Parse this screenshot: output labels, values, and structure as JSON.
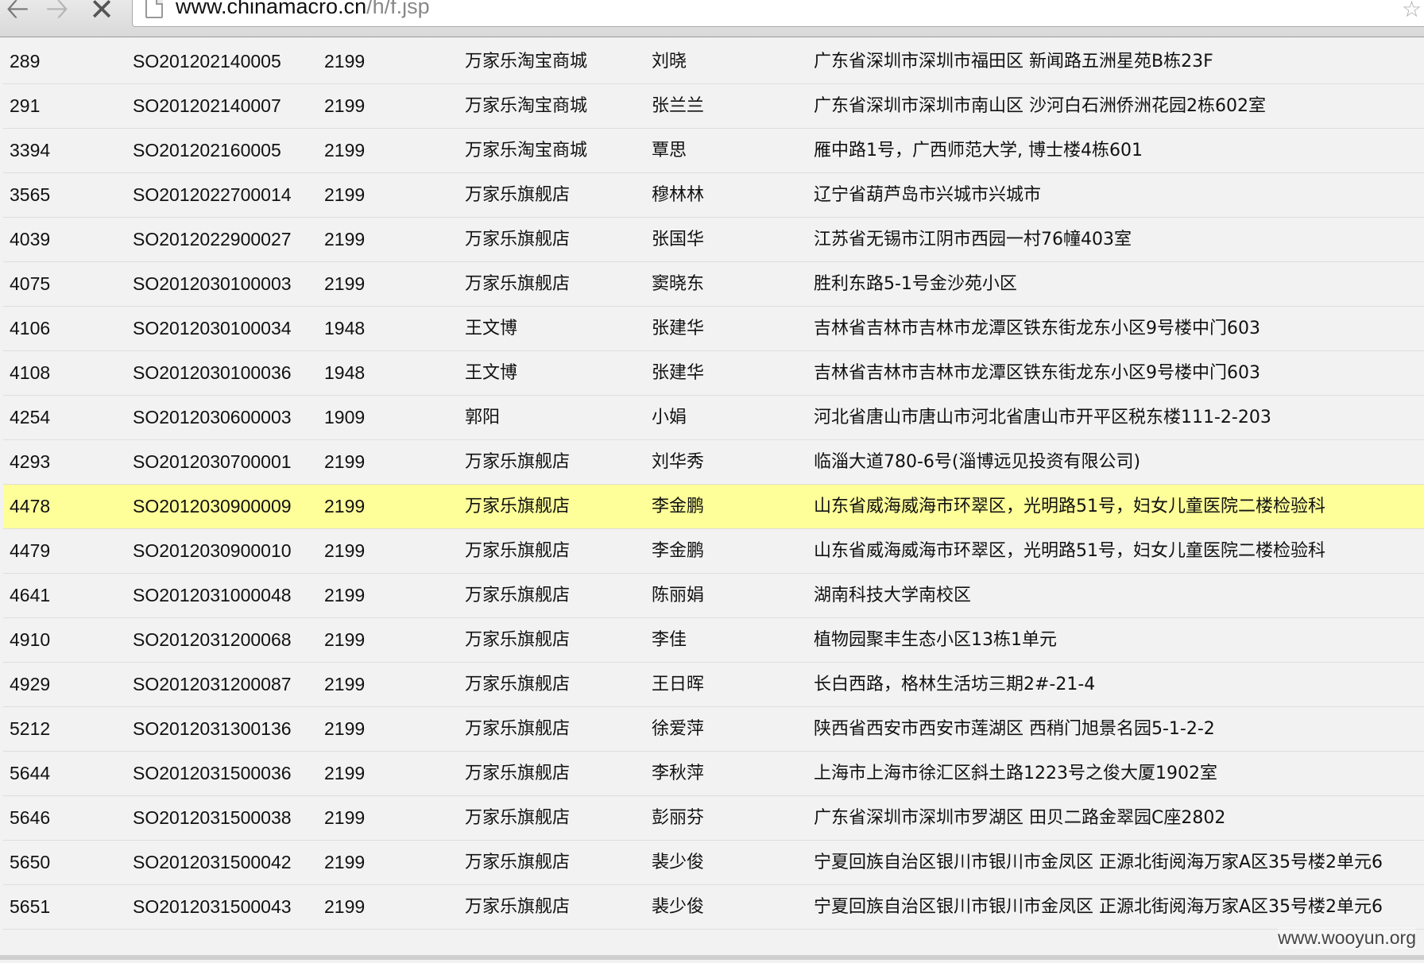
{
  "browser": {
    "url_host": "www.chinamacro.cn",
    "url_path": "/h/f.jsp",
    "back_icon": "🡠",
    "forward_icon": "🡢",
    "stop_icon": "✕",
    "star_icon": "☆"
  },
  "table": {
    "highlight_color": "#ffff99",
    "rows": [
      {
        "id": "289",
        "order": "SO201202140005",
        "code": "2199",
        "store": "万家乐淘宝商城",
        "name": "刘晓",
        "address": "广东省深圳市深圳市福田区 新闻路五洲星苑B栋23F"
      },
      {
        "id": "291",
        "order": "SO201202140007",
        "code": "2199",
        "store": "万家乐淘宝商城",
        "name": "张兰兰",
        "address": "广东省深圳市深圳市南山区 沙河白石洲侨洲花园2栋602室"
      },
      {
        "id": "3394",
        "order": "SO201202160005",
        "code": "2199",
        "store": "万家乐淘宝商城",
        "name": "覃思",
        "address": "雁中路1号，广西师范大学, 博士楼4栋601"
      },
      {
        "id": "3565",
        "order": "SO2012022700014",
        "code": "2199",
        "store": "万家乐旗舰店",
        "name": "穆林林",
        "address": "辽宁省葫芦岛市兴城市兴城市"
      },
      {
        "id": "4039",
        "order": "SO2012022900027",
        "code": "2199",
        "store": "万家乐旗舰店",
        "name": "张国华",
        "address": "江苏省无锡市江阴市西园一村76幢403室"
      },
      {
        "id": "4075",
        "order": "SO2012030100003",
        "code": "2199",
        "store": "万家乐旗舰店",
        "name": "窦晓东",
        "address": "胜利东路5-1号金沙苑小区"
      },
      {
        "id": "4106",
        "order": "SO2012030100034",
        "code": "1948",
        "store": "王文博",
        "name": "张建华",
        "address": "吉林省吉林市吉林市龙潭区铁东街龙东小区9号楼中门603"
      },
      {
        "id": "4108",
        "order": "SO2012030100036",
        "code": "1948",
        "store": "王文博",
        "name": "张建华",
        "address": "吉林省吉林市吉林市龙潭区铁东街龙东小区9号楼中门603"
      },
      {
        "id": "4254",
        "order": "SO2012030600003",
        "code": "1909",
        "store": "郭阳",
        "name": "小娟",
        "address": "河北省唐山市唐山市河北省唐山市开平区税东楼111-2-203"
      },
      {
        "id": "4293",
        "order": "SO2012030700001",
        "code": "2199",
        "store": "万家乐旗舰店",
        "name": "刘华秀",
        "address": "临淄大道780-6号(淄博远见投资有限公司)"
      },
      {
        "id": "4478",
        "order": "SO2012030900009",
        "code": "2199",
        "store": "万家乐旗舰店",
        "name": "李金鹏",
        "address": "山东省威海威海市环翠区，光明路51号，妇女儿童医院二楼检验科",
        "highlight": true
      },
      {
        "id": "4479",
        "order": "SO2012030900010",
        "code": "2199",
        "store": "万家乐旗舰店",
        "name": "李金鹏",
        "address": "山东省威海威海市环翠区，光明路51号，妇女儿童医院二楼检验科"
      },
      {
        "id": "4641",
        "order": "SO2012031000048",
        "code": "2199",
        "store": "万家乐旗舰店",
        "name": "陈丽娟",
        "address": "湖南科技大学南校区"
      },
      {
        "id": "4910",
        "order": "SO2012031200068",
        "code": "2199",
        "store": "万家乐旗舰店",
        "name": "李佳",
        "address": "植物园聚丰生态小区13栋1单元"
      },
      {
        "id": "4929",
        "order": "SO2012031200087",
        "code": "2199",
        "store": "万家乐旗舰店",
        "name": "王日晖",
        "address": "长白西路，格林生活坊三期2#-21-4"
      },
      {
        "id": "5212",
        "order": "SO2012031300136",
        "code": "2199",
        "store": "万家乐旗舰店",
        "name": "徐爱萍",
        "address": "陕西省西安市西安市莲湖区 西稍门旭景名园5-1-2-2"
      },
      {
        "id": "5644",
        "order": "SO2012031500036",
        "code": "2199",
        "store": "万家乐旗舰店",
        "name": "李秋萍",
        "address": "上海市上海市徐汇区斜土路1223号之俊大厦1902室"
      },
      {
        "id": "5646",
        "order": "SO2012031500038",
        "code": "2199",
        "store": "万家乐旗舰店",
        "name": "彭丽芬",
        "address": "广东省深圳市深圳市罗湖区 田贝二路金翠园C座2802"
      },
      {
        "id": "5650",
        "order": "SO2012031500042",
        "code": "2199",
        "store": "万家乐旗舰店",
        "name": "裴少俊",
        "address": "宁夏回族自治区银川市银川市金凤区 正源北街阅海万家A区35号楼2单元6"
      },
      {
        "id": "5651",
        "order": "SO2012031500043",
        "code": "2199",
        "store": "万家乐旗舰店",
        "name": "裴少俊",
        "address": "宁夏回族自治区银川市银川市金凤区 正源北街阅海万家A区35号楼2单元6"
      }
    ]
  },
  "watermark": "www.wooyun.org"
}
